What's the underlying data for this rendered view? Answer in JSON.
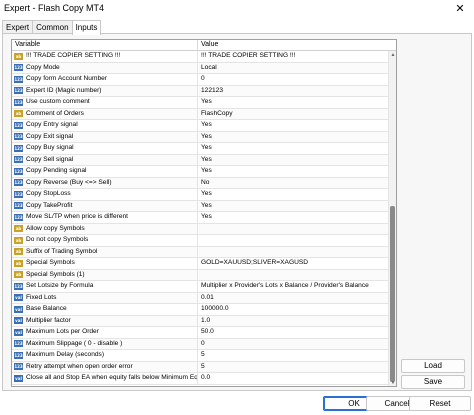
{
  "window": {
    "title": "Expert - Flash Copy MT4",
    "close_glyph": "✕"
  },
  "tabs": [
    {
      "label": "Expert"
    },
    {
      "label": "Common"
    },
    {
      "label": "Inputs"
    }
  ],
  "grid": {
    "col_variable": "Variable",
    "col_value": "Value",
    "rows": [
      {
        "icon": "ab",
        "variable": "!!! TRADE COPIER SETTING !!!",
        "value": "!!! TRADE COPIER SETTING !!!"
      },
      {
        "icon": "123",
        "variable": "Copy Mode",
        "value": "Local"
      },
      {
        "icon": "123",
        "variable": "Copy form Account Number",
        "value": "0"
      },
      {
        "icon": "123",
        "variable": "Expert ID (Magic number)",
        "value": "122123"
      },
      {
        "icon": "flag",
        "variable": "Use custom comment",
        "value": "Yes"
      },
      {
        "icon": "ab",
        "variable": "Comment of Orders",
        "value": "FlashCopy"
      },
      {
        "icon": "flag",
        "variable": "Copy Entry signal",
        "value": "Yes"
      },
      {
        "icon": "flag",
        "variable": "Copy Exit signal",
        "value": "Yes"
      },
      {
        "icon": "flag",
        "variable": "Copy Buy signal",
        "value": "Yes"
      },
      {
        "icon": "flag",
        "variable": "Copy Sell signal",
        "value": "Yes"
      },
      {
        "icon": "flag",
        "variable": "Copy Pending signal",
        "value": "Yes"
      },
      {
        "icon": "flag",
        "variable": "Copy Reverse (Buy <=> Sell)",
        "value": "No"
      },
      {
        "icon": "flag",
        "variable": "Copy StopLoss",
        "value": "Yes"
      },
      {
        "icon": "flag",
        "variable": "Copy TakeProfit",
        "value": "Yes"
      },
      {
        "icon": "flag",
        "variable": "Move SL/TP when price is different",
        "value": "Yes"
      },
      {
        "icon": "ab",
        "variable": "Allow copy Symbols",
        "value": ""
      },
      {
        "icon": "ab",
        "variable": "Do not copy Symbols",
        "value": ""
      },
      {
        "icon": "ab",
        "variable": "Suffix of Trading Symbol",
        "value": ""
      },
      {
        "icon": "ab",
        "variable": "Special Symbols",
        "value": "GOLD=XAUUSD;SLIVER=XAGUSD"
      },
      {
        "icon": "ab",
        "variable": "Special Symbols (1)",
        "value": ""
      },
      {
        "icon": "123",
        "variable": "Set Lotsize by Formula",
        "value": "Multiplier x Provider's Lots x Balance / Provider's Balance"
      },
      {
        "icon": "val",
        "variable": "Fixed Lots",
        "value": "0.01"
      },
      {
        "icon": "val",
        "variable": "Base Balance",
        "value": "100000.0"
      },
      {
        "icon": "val",
        "variable": "Multiplier factor",
        "value": "1.0"
      },
      {
        "icon": "val",
        "variable": "Maximum Lots per Order",
        "value": "50.0"
      },
      {
        "icon": "123",
        "variable": "Maximum Slippage ( 0 - disable )",
        "value": "0"
      },
      {
        "icon": "123",
        "variable": "Maximum Delay (seconds)",
        "value": "5"
      },
      {
        "icon": "123",
        "variable": "Retry attempt when open order error",
        "value": "5"
      },
      {
        "icon": "val",
        "variable": "Close all and Stop EA when equity falls below Minimum Equity",
        "value": "0.0"
      }
    ]
  },
  "icons": {
    "ab": {
      "name": "string-type-icon",
      "glyph": "ab"
    },
    "123": {
      "name": "integer-type-icon",
      "glyph": "123"
    },
    "flag": {
      "name": "bool-type-icon",
      "glyph": "123"
    },
    "val": {
      "name": "double-type-icon",
      "glyph": "val"
    }
  },
  "side_buttons": {
    "load": "Load",
    "save": "Save"
  },
  "footer_buttons": {
    "ok": "OK",
    "cancel": "Cancel",
    "reset": "Reset"
  },
  "scrollbar": {
    "up_glyph": "▲",
    "down_glyph": "▼"
  },
  "colors": {
    "accent": "#2a6fd6",
    "string_icon": "#c9a227",
    "number_icon": "#3a6fb5"
  }
}
